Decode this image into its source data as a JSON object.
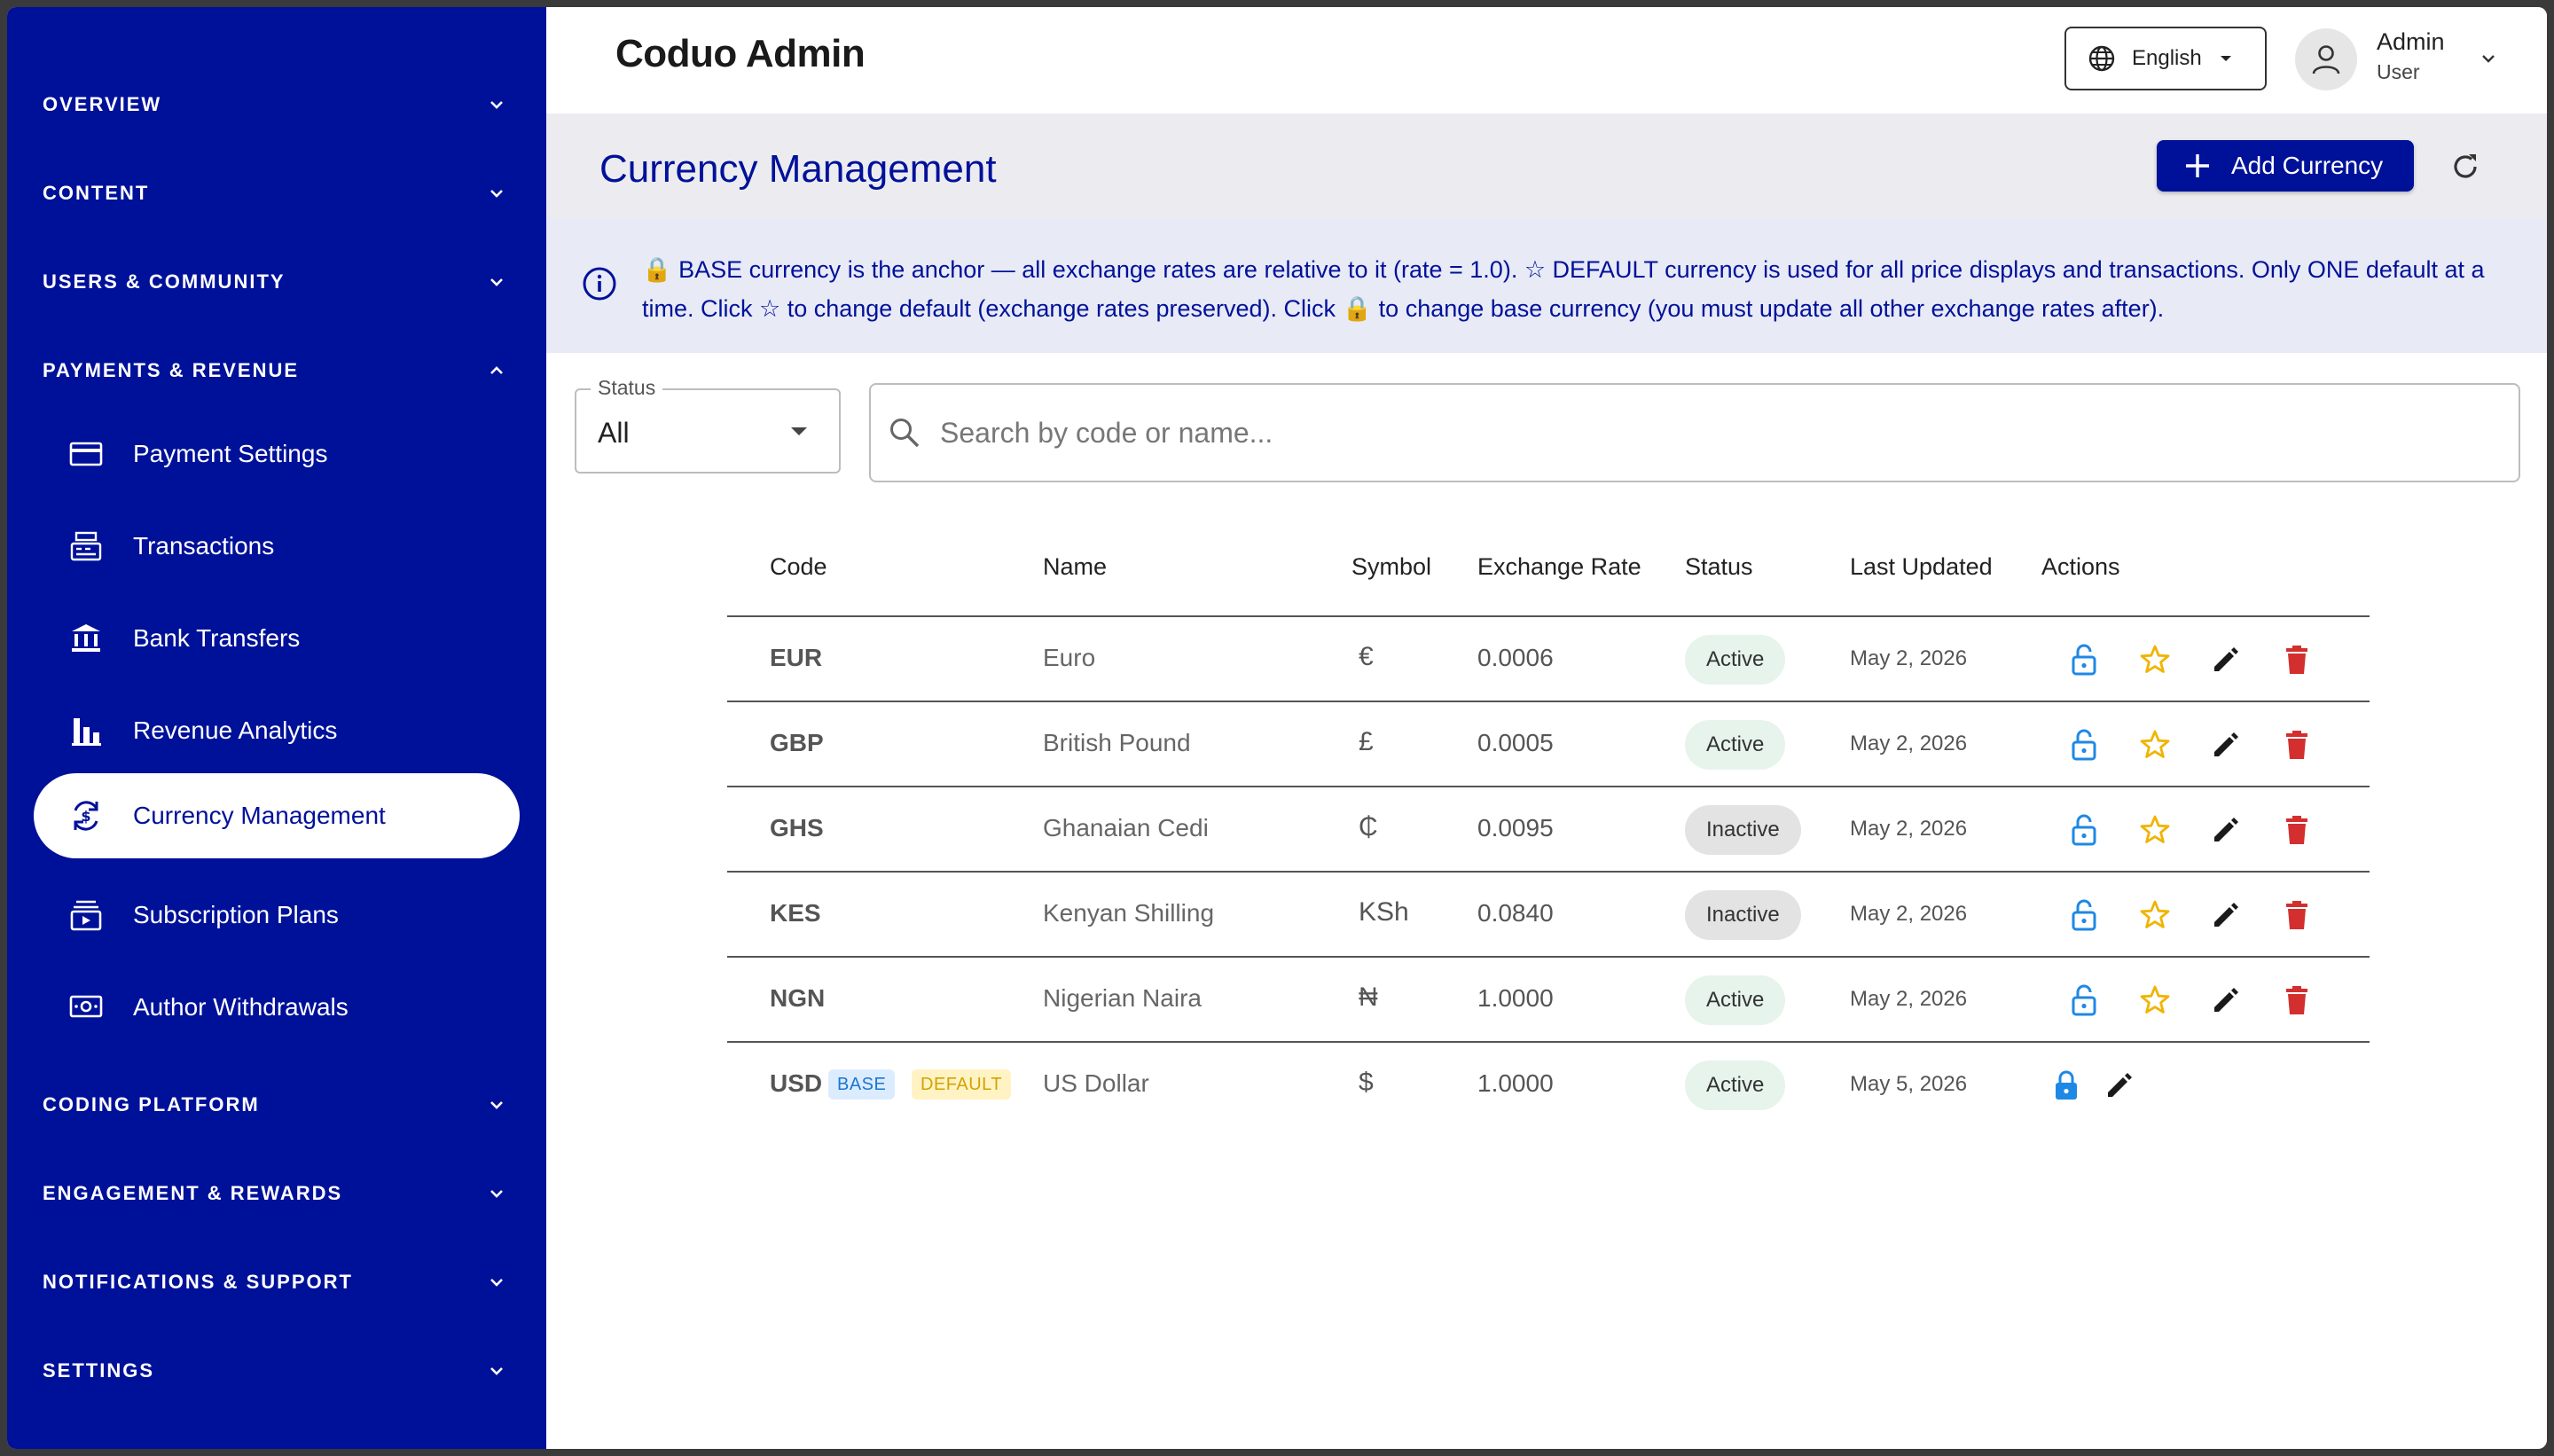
{
  "app": {
    "title": "Coduo Admin"
  },
  "header": {
    "language": "English",
    "user_name": "Admin",
    "user_role": "User"
  },
  "sidebar": {
    "sections": [
      {
        "label": "OVERVIEW",
        "expanded": false
      },
      {
        "label": "CONTENT",
        "expanded": false
      },
      {
        "label": "USERS & COMMUNITY",
        "expanded": false
      },
      {
        "label": "PAYMENTS & REVENUE",
        "expanded": true
      },
      {
        "label": "CODING PLATFORM",
        "expanded": false
      },
      {
        "label": "ENGAGEMENT & REWARDS",
        "expanded": false
      },
      {
        "label": "NOTIFICATIONS & SUPPORT",
        "expanded": false
      },
      {
        "label": "SETTINGS",
        "expanded": false
      }
    ],
    "items": [
      {
        "label": "Payment Settings",
        "icon": "credit-card-icon"
      },
      {
        "label": "Transactions",
        "icon": "cash-register-icon"
      },
      {
        "label": "Bank Transfers",
        "icon": "bank-icon"
      },
      {
        "label": "Revenue Analytics",
        "icon": "bar-chart-icon"
      },
      {
        "label": "Currency Management",
        "icon": "currency-exchange-icon",
        "active": true
      },
      {
        "label": "Subscription Plans",
        "icon": "subscriptions-icon"
      },
      {
        "label": "Author Withdrawals",
        "icon": "payments-icon"
      }
    ]
  },
  "page": {
    "title": "Currency Management",
    "add_label": "Add Currency",
    "info": "🔒 BASE currency is the anchor — all exchange rates are relative to it (rate = 1.0). ☆ DEFAULT currency is used for all price displays and transactions. Only ONE default at a time. Click ☆ to change default (exchange rates preserved). Click 🔒 to change base currency (you must update all other exchange rates after)."
  },
  "filters": {
    "status_label": "Status",
    "status_value": "All",
    "search_placeholder": "Search by code or name...",
    "search_value": ""
  },
  "table": {
    "columns": [
      "Code",
      "Name",
      "Symbol",
      "Exchange Rate",
      "Status",
      "Last Updated",
      "Actions"
    ],
    "rows": [
      {
        "code": "EUR",
        "name": "Euro",
        "symbol": "€",
        "rate": "0.0006",
        "status": "Active",
        "updated": "May 2, 2026"
      },
      {
        "code": "GBP",
        "name": "British Pound",
        "symbol": "£",
        "rate": "0.0005",
        "status": "Active",
        "updated": "May 2, 2026"
      },
      {
        "code": "GHS",
        "name": "Ghanaian Cedi",
        "symbol": "₵",
        "rate": "0.0095",
        "status": "Inactive",
        "updated": "May 2, 2026"
      },
      {
        "code": "KES",
        "name": "Kenyan Shilling",
        "symbol": "KSh",
        "rate": "0.0840",
        "status": "Inactive",
        "updated": "May 2, 2026"
      },
      {
        "code": "NGN",
        "name": "Nigerian Naira",
        "symbol": "₦",
        "rate": "1.0000",
        "status": "Active",
        "updated": "May 2, 2026"
      },
      {
        "code": "USD",
        "name": "US Dollar",
        "symbol": "$",
        "rate": "1.0000",
        "status": "Active",
        "updated": "May 5, 2026",
        "tags": [
          "BASE",
          "DEFAULT"
        ]
      }
    ]
  },
  "colors": {
    "sidebar": "#001199",
    "accent": "#001199",
    "lock_blue": "#1e88e5",
    "star_yellow": "#f0b400",
    "delete_red": "#d32f2f"
  }
}
